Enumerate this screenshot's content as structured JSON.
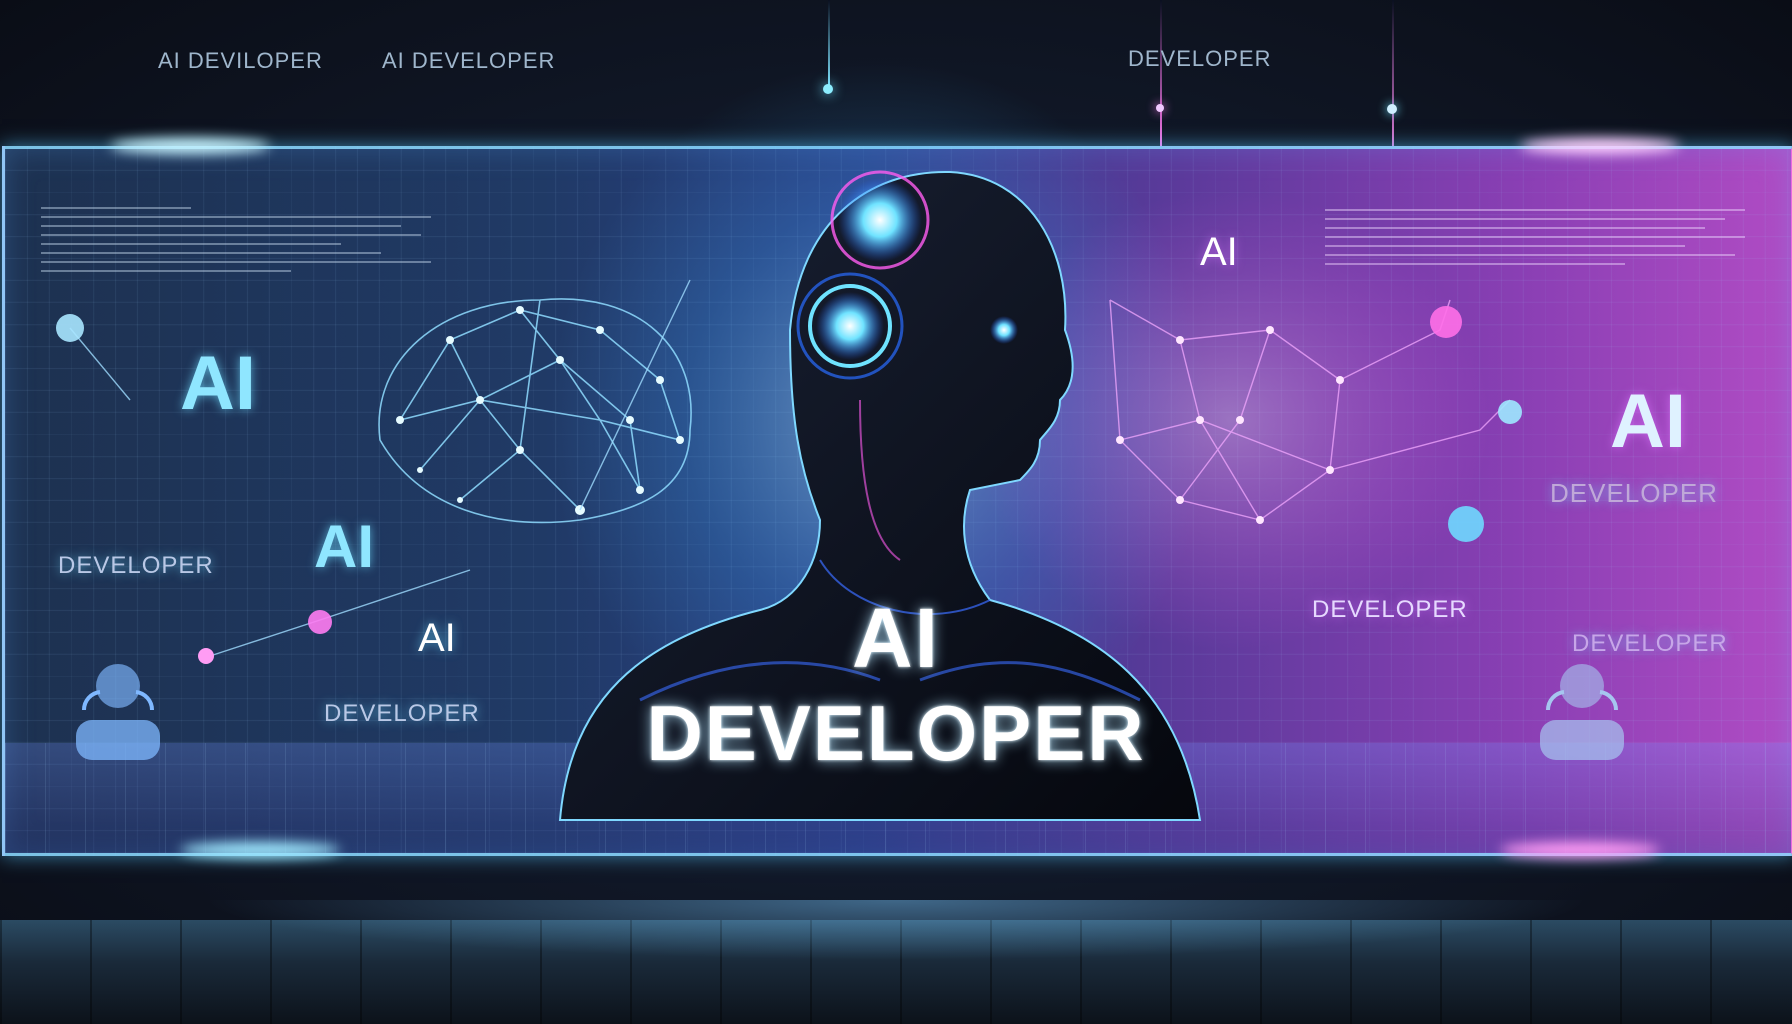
{
  "palette": {
    "cyan": "#6fe3ff",
    "blue": "#3a6cff",
    "magenta": "#ff5cf0",
    "deep_purple": "#6a2fb0",
    "white_text": "#ffffff"
  },
  "header_labels": {
    "left_1": "AI DEVILOPER",
    "left_2": "AI DEVELOPER",
    "right": "DEVELOPER"
  },
  "main_title": {
    "line1": "AI",
    "line2": "DEVELOPER"
  },
  "left_labels": {
    "ai_big": "AI",
    "ai_mid": "AI",
    "ai_small": "AI",
    "developer_1": "DEVELOPER",
    "developer_2": "DEVELOPER"
  },
  "right_labels": {
    "ai_top": "AI",
    "ai_big": "AI",
    "developer_faded": "DEVELOPER",
    "developer_1": "DEVELOPER",
    "developer_2": "DEVELOPER"
  },
  "icons": [
    "user-icon",
    "user-icon"
  ]
}
